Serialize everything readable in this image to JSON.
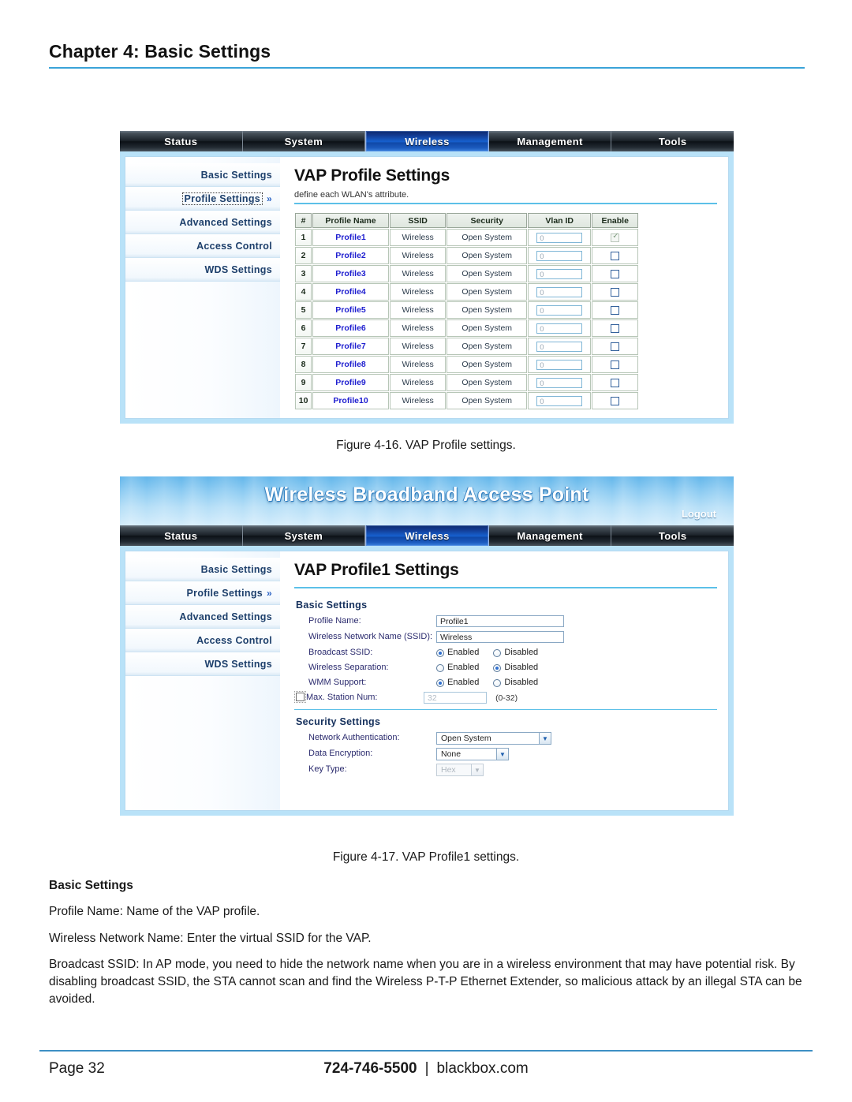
{
  "page": {
    "chapter_title": "Chapter 4: Basic Settings",
    "page_label": "Page 32",
    "phone": "724-746-5500",
    "separator": "|",
    "website": "blackbox.com",
    "accent_color": "#3aa3d8"
  },
  "figure_16": {
    "caption": "Figure 4-16. VAP Profile settings.",
    "nav_tabs": [
      {
        "label": "Status",
        "active": false
      },
      {
        "label": "System",
        "active": false
      },
      {
        "label": "Wireless",
        "active": true
      },
      {
        "label": "Management",
        "active": false
      },
      {
        "label": "Tools",
        "active": false
      }
    ],
    "sidebar": [
      {
        "label": "Basic Settings",
        "chevron": "",
        "selected": false
      },
      {
        "label": "Profile Settings",
        "chevron": "»",
        "selected": true
      },
      {
        "label": "Advanced Settings",
        "chevron": "",
        "selected": false
      },
      {
        "label": "Access Control",
        "chevron": "",
        "selected": false
      },
      {
        "label": "WDS Settings",
        "chevron": "",
        "selected": false
      }
    ],
    "title": "VAP Profile Settings",
    "subtitle": "define each WLAN's attribute.",
    "table": {
      "columns": [
        "#",
        "Profile Name",
        "SSID",
        "Security",
        "Vlan ID",
        "Enable"
      ],
      "rows": [
        {
          "idx": "1",
          "name": "Profile1",
          "ssid": "Wireless",
          "security": "Open System",
          "vlan": "0",
          "enabled": true,
          "locked": true
        },
        {
          "idx": "2",
          "name": "Profile2",
          "ssid": "Wireless",
          "security": "Open System",
          "vlan": "0",
          "enabled": false,
          "locked": false
        },
        {
          "idx": "3",
          "name": "Profile3",
          "ssid": "Wireless",
          "security": "Open System",
          "vlan": "0",
          "enabled": false,
          "locked": false
        },
        {
          "idx": "4",
          "name": "Profile4",
          "ssid": "Wireless",
          "security": "Open System",
          "vlan": "0",
          "enabled": false,
          "locked": false
        },
        {
          "idx": "5",
          "name": "Profile5",
          "ssid": "Wireless",
          "security": "Open System",
          "vlan": "0",
          "enabled": false,
          "locked": false
        },
        {
          "idx": "6",
          "name": "Profile6",
          "ssid": "Wireless",
          "security": "Open System",
          "vlan": "0",
          "enabled": false,
          "locked": false
        },
        {
          "idx": "7",
          "name": "Profile7",
          "ssid": "Wireless",
          "security": "Open System",
          "vlan": "0",
          "enabled": false,
          "locked": false
        },
        {
          "idx": "8",
          "name": "Profile8",
          "ssid": "Wireless",
          "security": "Open System",
          "vlan": "0",
          "enabled": false,
          "locked": false
        },
        {
          "idx": "9",
          "name": "Profile9",
          "ssid": "Wireless",
          "security": "Open System",
          "vlan": "0",
          "enabled": false,
          "locked": false
        },
        {
          "idx": "10",
          "name": "Profile10",
          "ssid": "Wireless",
          "security": "Open System",
          "vlan": "0",
          "enabled": false,
          "locked": false
        }
      ]
    }
  },
  "figure_17": {
    "caption": "Figure 4-17. VAP Profile1 settings.",
    "banner_title": "Wireless Broadband Access Point",
    "logout_label": "Logout",
    "nav_tabs": [
      {
        "label": "Status",
        "active": false
      },
      {
        "label": "System",
        "active": false
      },
      {
        "label": "Wireless",
        "active": true
      },
      {
        "label": "Management",
        "active": false
      },
      {
        "label": "Tools",
        "active": false
      }
    ],
    "sidebar": [
      {
        "label": "Basic Settings",
        "chevron": "",
        "selected": false
      },
      {
        "label": "Profile Settings",
        "chevron": "»",
        "selected": false
      },
      {
        "label": "Advanced Settings",
        "chevron": "",
        "selected": false
      },
      {
        "label": "Access Control",
        "chevron": "",
        "selected": false
      },
      {
        "label": "WDS Settings",
        "chevron": "",
        "selected": false
      }
    ],
    "title": "VAP Profile1 Settings",
    "basic_heading": "Basic Settings",
    "fields": {
      "profile_name_label": "Profile Name:",
      "profile_name_value": "Profile1",
      "ssid_label": "Wireless Network Name (SSID):",
      "ssid_value": "Wireless",
      "broadcast_ssid_label": "Broadcast SSID:",
      "broadcast_ssid_value": "Enabled",
      "wireless_separation_label": "Wireless Separation:",
      "wireless_separation_value": "Disabled",
      "wmm_support_label": "WMM Support:",
      "wmm_support_value": "Enabled",
      "max_station_label": "Max. Station Num:",
      "max_station_value": "32",
      "max_station_range": "(0-32)",
      "max_station_checked": false,
      "enabled_label": "Enabled",
      "disabled_label": "Disabled"
    },
    "security_heading": "Security Settings",
    "security": {
      "network_auth_label": "Network Authentication:",
      "network_auth_value": "Open System",
      "data_encryption_label": "Data Encryption:",
      "data_encryption_value": "None",
      "key_type_label": "Key Type:",
      "key_type_value": "Hex"
    }
  },
  "prose": {
    "heading": "Basic Settings",
    "p1": "Profile Name: Name of the VAP profile.",
    "p2": "Wireless Network Name: Enter the virtual SSID for the VAP.",
    "p3": "Broadcast SSID: In AP mode, you need to hide the network name when you are in a wireless environment that may have potential risk. By disabling broadcast SSID, the STA cannot scan and find the Wireless P-T-P Ethernet Extender, so malicious attack by an illegal STA can be avoided."
  }
}
